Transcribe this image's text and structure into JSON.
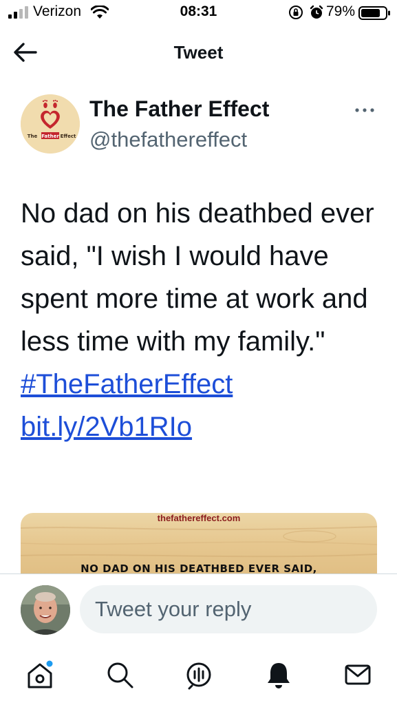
{
  "status_bar": {
    "carrier": "Verizon",
    "time": "08:31",
    "battery_percent": "79%",
    "icons": [
      "signal-icon",
      "wifi-icon",
      "orientation-lock-icon",
      "alarm-icon",
      "battery-icon"
    ]
  },
  "header": {
    "title": "Tweet",
    "back_icon": "back-arrow-icon"
  },
  "tweet": {
    "author_name": "The Father Effect",
    "author_handle": "@thefathereffect",
    "avatar_logo_text": "The Father Effect",
    "text": "No dad on his deathbed ever said, \"I wish I would have spent more time at work and less time with my family.\"",
    "hashtag": "#TheFatherEffect",
    "link": "bit.ly/2Vb1RIo",
    "media": {
      "site": "thefathereffect.com",
      "headline": "NO DAD ON HIS DEATHBED EVER SAID,"
    },
    "more_icon": "more-options-icon"
  },
  "reply": {
    "placeholder": "Tweet your reply"
  },
  "tab_bar": {
    "items": [
      "home-icon",
      "search-icon",
      "spaces-icon",
      "notifications-icon",
      "messages-icon"
    ],
    "accent": "#1d9bf0"
  },
  "colors": {
    "text": "#0f1419",
    "secondary": "#536471",
    "link": "#1d4ed8"
  }
}
